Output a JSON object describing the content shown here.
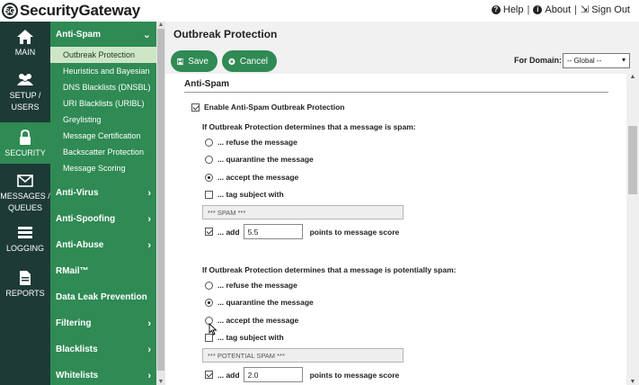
{
  "brand": {
    "name": "SecurityGateway",
    "mark_text": "SG"
  },
  "top_links": {
    "help": "Help",
    "about": "About",
    "signout": "Sign Out",
    "sep": "|"
  },
  "icon_nav": [
    {
      "label_1": "MAIN",
      "label_2": ""
    },
    {
      "label_1": "SETUP /",
      "label_2": "USERS"
    },
    {
      "label_1": "SECURITY",
      "label_2": ""
    },
    {
      "label_1": "MESSAGES /",
      "label_2": "QUEUES"
    },
    {
      "label_1": "LOGGING",
      "label_2": ""
    },
    {
      "label_1": "REPORTS",
      "label_2": ""
    }
  ],
  "submenu": {
    "group": "Anti-Spam",
    "children": [
      "Outbreak Protection",
      "Heuristics and Bayesian",
      "DNS Blacklists (DNSBL)",
      "URI Blacklists (URIBL)",
      "Greylisting",
      "Message Certification",
      "Backscatter Protection",
      "Message Scoring"
    ],
    "sections": [
      "Anti-Virus",
      "Anti-Spoofing",
      "Anti-Abuse",
      "RMail™",
      "Data Leak Prevention",
      "Filtering",
      "Blacklists",
      "Whitelists"
    ]
  },
  "page": {
    "title": "Outbreak Protection",
    "save_label": "Save",
    "cancel_label": "Cancel",
    "domain_label": "For Domain:",
    "domain_value": "-- Global --"
  },
  "form": {
    "section_title": "Anti-Spam",
    "enable_label": "Enable Anti-Spam Outbreak Protection",
    "spam": {
      "heading": "If Outbreak Protection determines that a message is spam:",
      "refuse": "... refuse the message",
      "quarantine": "... quarantine the message",
      "accept": "... accept the message",
      "tag": "... tag subject with",
      "tag_value": "*** SPAM ***",
      "add": "... add",
      "points": "5.5",
      "points_suffix": "points to message score"
    },
    "potential": {
      "heading": "If Outbreak Protection determines that a message is potentially spam:",
      "refuse": "... refuse the message",
      "quarantine": "... quarantine the message",
      "accept": "... accept the message",
      "tag": "... tag subject with",
      "tag_value": "*** POTENTIAL SPAM ***",
      "add": "... add",
      "points": "2.0",
      "points_suffix": "points to message score"
    }
  },
  "colors": {
    "nav_bg": "#1e3a36",
    "accent": "#2f8a54",
    "active_child": "#cfe6c6"
  }
}
